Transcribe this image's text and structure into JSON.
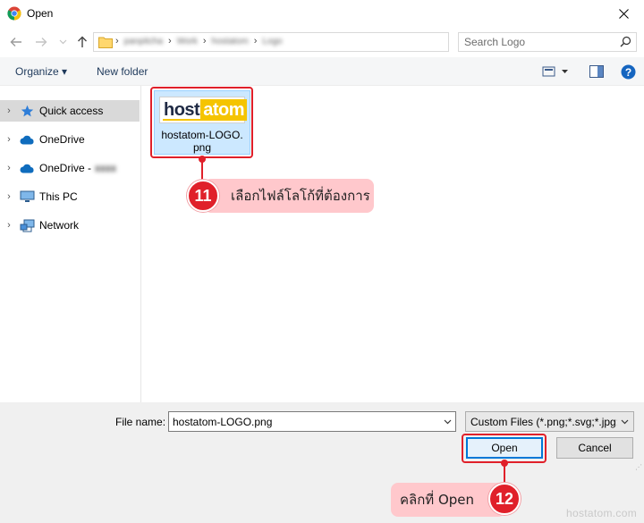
{
  "window": {
    "title": "Open",
    "app_icon": "chrome-icon",
    "close_icon": "close-icon"
  },
  "address": {
    "crumbs": [
      "panpitcha",
      "Work",
      "hostatom",
      "Logo"
    ],
    "search_placeholder": "Search Logo"
  },
  "toolbar": {
    "organize_label": "Organize ▾",
    "new_folder_label": "New folder"
  },
  "sidebar": {
    "items": [
      {
        "label": "Quick access",
        "icon": "star-icon",
        "selected": true
      },
      {
        "label": "OneDrive",
        "icon": "cloud-icon"
      },
      {
        "label": "OneDrive -",
        "icon": "cloud-icon",
        "blurred_suffix": "xxxx"
      },
      {
        "label": "This PC",
        "icon": "pc-icon"
      },
      {
        "label": "Network",
        "icon": "network-icon"
      }
    ]
  },
  "files": [
    {
      "name_line1": "hostatom-LOGO.",
      "name_line2": "png",
      "thumb_host": "host",
      "thumb_atom": "atom"
    }
  ],
  "bottom": {
    "file_name_label": "File name:",
    "file_name_value": "hostatom-LOGO.png",
    "file_type_value": "Custom Files (*.png;*.svg;*.jpg;",
    "open_label": "Open",
    "cancel_label": "Cancel"
  },
  "annotations": {
    "step1_number": "11",
    "step1_text": "เลือกไฟล์โลโก้ที่ต้องการ",
    "step2_number": "12",
    "step2_text": "คลิกที่ Open",
    "accent_color": "#e0202a",
    "callout_color": "#ffc8cc"
  },
  "watermark": "hostatom.com"
}
